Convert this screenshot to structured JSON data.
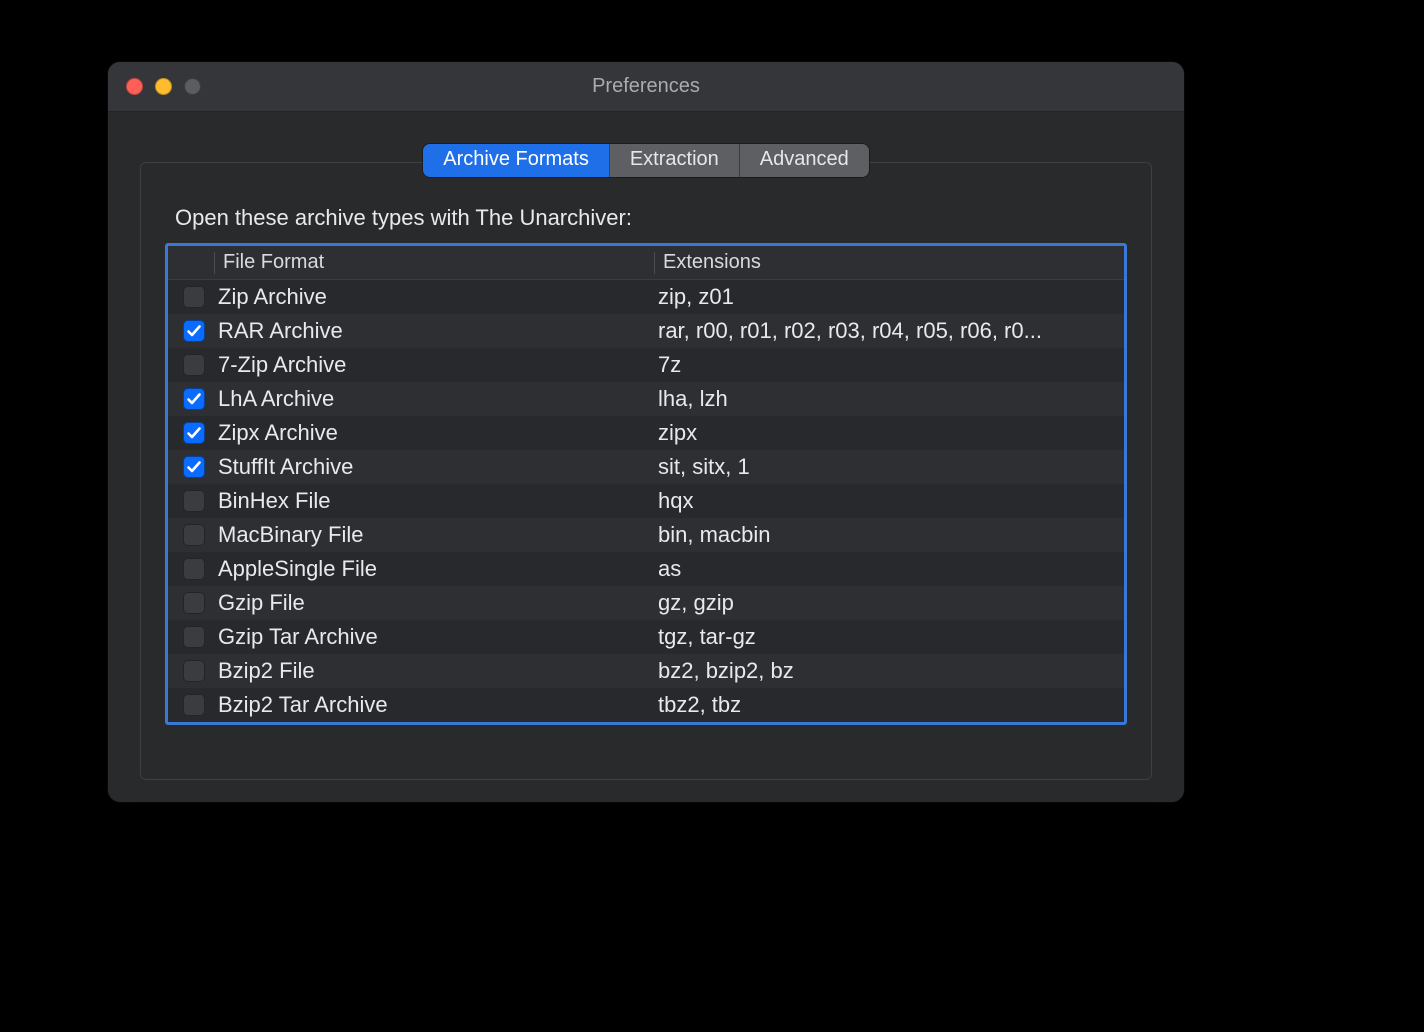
{
  "window": {
    "title": "Preferences"
  },
  "tabs": [
    {
      "label": "Archive Formats",
      "active": true
    },
    {
      "label": "Extraction",
      "active": false
    },
    {
      "label": "Advanced",
      "active": false
    }
  ],
  "group_label": "Open these archive types with The Unarchiver:",
  "columns": {
    "format": "File Format",
    "extensions": "Extensions"
  },
  "rows": [
    {
      "checked": false,
      "format": "Zip Archive",
      "extensions": "zip, z01"
    },
    {
      "checked": true,
      "format": "RAR Archive",
      "extensions": "rar, r00, r01, r02, r03, r04, r05, r06, r0..."
    },
    {
      "checked": false,
      "format": "7-Zip Archive",
      "extensions": "7z"
    },
    {
      "checked": true,
      "format": "LhA Archive",
      "extensions": "lha, lzh"
    },
    {
      "checked": true,
      "format": "Zipx Archive",
      "extensions": "zipx"
    },
    {
      "checked": true,
      "format": "StuffIt Archive",
      "extensions": "sit, sitx, 1"
    },
    {
      "checked": false,
      "format": "BinHex File",
      "extensions": "hqx"
    },
    {
      "checked": false,
      "format": "MacBinary File",
      "extensions": "bin, macbin"
    },
    {
      "checked": false,
      "format": "AppleSingle File",
      "extensions": "as"
    },
    {
      "checked": false,
      "format": "Gzip File",
      "extensions": "gz, gzip"
    },
    {
      "checked": false,
      "format": "Gzip Tar Archive",
      "extensions": "tgz, tar-gz"
    },
    {
      "checked": false,
      "format": "Bzip2 File",
      "extensions": "bz2, bzip2, bz"
    },
    {
      "checked": false,
      "format": "Bzip2 Tar Archive",
      "extensions": "tbz2, tbz"
    }
  ]
}
